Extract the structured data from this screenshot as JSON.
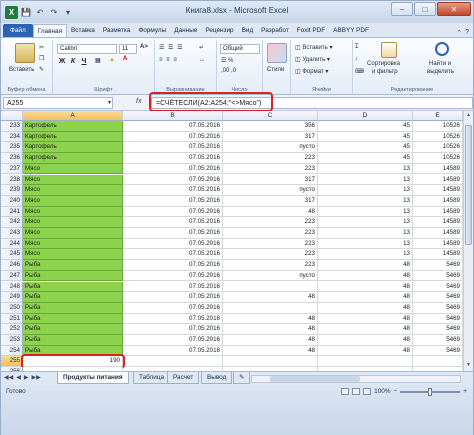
{
  "window": {
    "title": "Книга8.xlsx - Microsoft Excel",
    "app_icon_letter": "X"
  },
  "tabs": [
    "Файл",
    "Главная",
    "Вставка",
    "Разметка",
    "Формулы",
    "Данные",
    "Рецензир",
    "Вид",
    "Разработ",
    "Foxit PDF",
    "ABBYY PDF"
  ],
  "ribbon": {
    "paste_label": "Вставить",
    "clipboard_label": "Буфер обмена",
    "font_name": "Calibri",
    "font_size": "11",
    "font_group_label": "Шрифт",
    "align_group_label": "Выравнивание",
    "number_format": "Общий",
    "number_group_label": "Число",
    "styles_label": "Стили",
    "insert_label": "Вставить",
    "delete_label": "Удалить",
    "format_label": "Формат",
    "cells_group_label": "Ячейки",
    "sort_label_1": "Сортировка",
    "sort_label_2": "и фильтр",
    "find_label_1": "Найти и",
    "find_label_2": "выделить",
    "edit_group_label": "Редактирование",
    "bold": "Ж",
    "italic": "К",
    "underline": "Ч"
  },
  "formula_bar": {
    "name_box": "A255",
    "fx": "fx",
    "formula": "=СЧЁТЕСЛИ(A2:A254;\"<>Мясо\")"
  },
  "columns": [
    "A",
    "B",
    "C",
    "D",
    "E"
  ],
  "rows": [
    {
      "n": "233",
      "a": "Картофель",
      "b": "07.05.2016",
      "c": "356",
      "d": "45",
      "e": "10526"
    },
    {
      "n": "234",
      "a": "Картофель",
      "b": "07.05.2016",
      "c": "317",
      "d": "45",
      "e": "10526"
    },
    {
      "n": "235",
      "a": "Картофель",
      "b": "07.05.2016",
      "c": "пусто",
      "d": "45",
      "e": "10526"
    },
    {
      "n": "236",
      "a": "Картофель",
      "b": "07.05.2016",
      "c": "223",
      "d": "45",
      "e": "10526"
    },
    {
      "n": "237",
      "a": "Мясо",
      "b": "07.05.2016",
      "c": "223",
      "d": "13",
      "e": "14589"
    },
    {
      "n": "238",
      "a": "Мясо",
      "b": "07.05.2016",
      "c": "317",
      "d": "13",
      "e": "14589"
    },
    {
      "n": "239",
      "a": "Мясо",
      "b": "07.05.2016",
      "c": "пусто",
      "d": "13",
      "e": "14589"
    },
    {
      "n": "240",
      "a": "Мясо",
      "b": "07.05.2016",
      "c": "317",
      "d": "13",
      "e": "14589"
    },
    {
      "n": "241",
      "a": "Мясо",
      "b": "07.05.2016",
      "c": "48",
      "d": "13",
      "e": "14589"
    },
    {
      "n": "242",
      "a": "Мясо",
      "b": "07.05.2016",
      "c": "223",
      "d": "13",
      "e": "14589"
    },
    {
      "n": "243",
      "a": "Мясо",
      "b": "07.05.2016",
      "c": "223",
      "d": "13",
      "e": "14589"
    },
    {
      "n": "244",
      "a": "Мясо",
      "b": "07.05.2016",
      "c": "223",
      "d": "13",
      "e": "14589"
    },
    {
      "n": "245",
      "a": "Мясо",
      "b": "07.05.2016",
      "c": "223",
      "d": "13",
      "e": "14589"
    },
    {
      "n": "246",
      "a": "Рыба",
      "b": "07.05.2016",
      "c": "223",
      "d": "48",
      "e": "5469"
    },
    {
      "n": "247",
      "a": "Рыба",
      "b": "07.05.2016",
      "c": "пусто",
      "d": "48",
      "e": "5469"
    },
    {
      "n": "248",
      "a": "Рыба",
      "b": "07.05.2016",
      "c": "",
      "d": "48",
      "e": "5469"
    },
    {
      "n": "249",
      "a": "Рыба",
      "b": "07.05.2016",
      "c": "48",
      "d": "48",
      "e": "5469"
    },
    {
      "n": "250",
      "a": "Рыба",
      "b": "07.05.2016",
      "c": "",
      "d": "48",
      "e": "5469"
    },
    {
      "n": "251",
      "a": "Рыба",
      "b": "07.05.2016",
      "c": "48",
      "d": "48",
      "e": "5469"
    },
    {
      "n": "252",
      "a": "Рыба",
      "b": "07.05.2016",
      "c": "48",
      "d": "48",
      "e": "5469"
    },
    {
      "n": "253",
      "a": "Рыба",
      "b": "07.05.2016",
      "c": "48",
      "d": "48",
      "e": "5469"
    },
    {
      "n": "254",
      "a": "Рыба",
      "b": "07.05.2016",
      "c": "48",
      "d": "48",
      "e": "5469"
    },
    {
      "n": "255",
      "a": "190",
      "b": "",
      "c": "",
      "d": "",
      "e": ""
    },
    {
      "n": "256",
      "a": "",
      "b": "",
      "c": "",
      "d": "",
      "e": ""
    }
  ],
  "sheet_tabs": [
    "Продукты питания",
    "Таблица",
    "Расчет",
    "Вывод"
  ],
  "status": {
    "ready": "Готово",
    "zoom": "100%"
  },
  "colors": {
    "highlight_green": "#8cd24c",
    "annotation_red": "#e02020",
    "file_tab_blue": "#2a64b5"
  }
}
